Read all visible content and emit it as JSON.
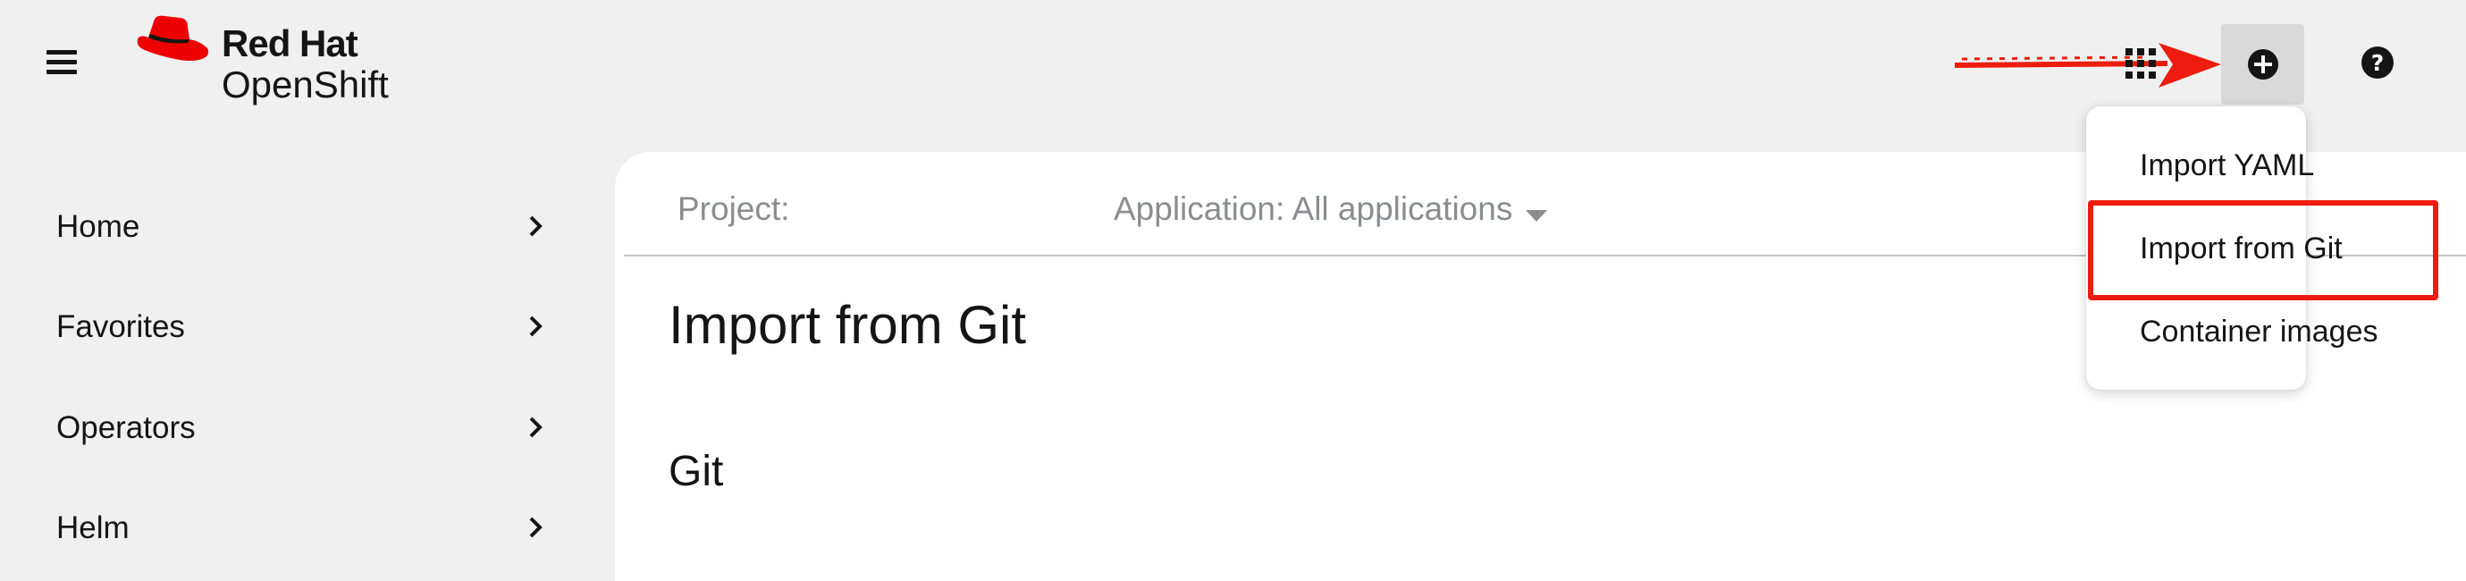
{
  "masthead": {
    "brand": "Red Hat",
    "product": "OpenShift",
    "icons": {
      "menu": "hamburger-icon",
      "apps": "grid-icon",
      "add": "plus-circle-icon",
      "help": "question-circle-icon"
    }
  },
  "sidebar": {
    "items": [
      {
        "label": "Home"
      },
      {
        "label": "Favorites"
      },
      {
        "label": "Operators"
      },
      {
        "label": "Helm"
      }
    ]
  },
  "context_bar": {
    "project_label": "Project:",
    "application_label": "Application: All applications"
  },
  "main": {
    "title": "Import from Git",
    "section_title": "Git"
  },
  "add_menu": {
    "items": [
      {
        "label": "Import YAML"
      },
      {
        "label": "Import from Git"
      },
      {
        "label": "Container images"
      }
    ]
  },
  "colors": {
    "brand_red": "#ee0000",
    "annotation_red": "#ee1c0e",
    "masthead_bg": "#f0f0f0",
    "panel_bg": "#ffffff"
  }
}
